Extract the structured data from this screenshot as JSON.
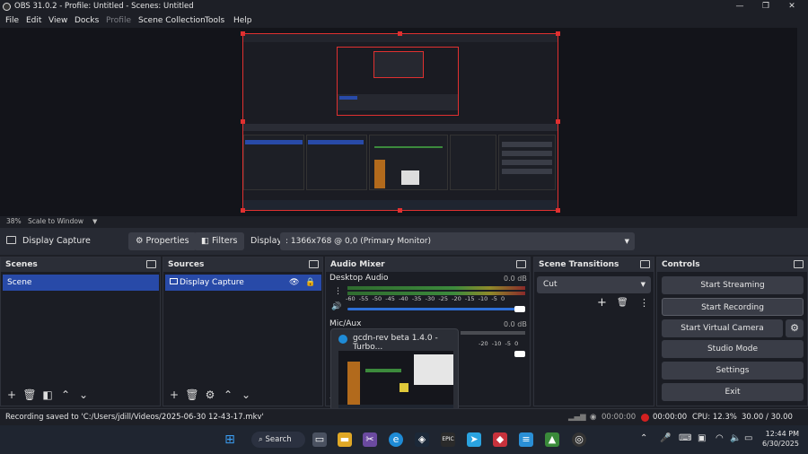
{
  "window": {
    "title": "OBS 31.0.2 - Profile: Untitled - Scenes: Untitled",
    "min": "—",
    "max": "❐",
    "close": "✕"
  },
  "menu": [
    "File",
    "Edit",
    "View",
    "Docks",
    "Profile",
    "Scene Collection",
    "Tools",
    "Help"
  ],
  "preview": {
    "zoom": "38%",
    "scale_mode": "Scale to Window",
    "border_color": "#e03030"
  },
  "source_toolbar": {
    "source_name": "Display Capture",
    "properties": "Properties",
    "filters": "Filters",
    "display_label": "Display",
    "display_value": ": 1366x768 @ 0,0 (Primary Monitor)"
  },
  "scenes": {
    "title": "Scenes",
    "items": [
      "Scene"
    ]
  },
  "sources": {
    "title": "Sources",
    "items": [
      "Display Capture"
    ]
  },
  "audio": {
    "title": "Audio Mixer",
    "channels": [
      {
        "name": "Desktop Audio",
        "db": "0.0 dB"
      },
      {
        "name": "Mic/Aux",
        "db": "0.0 dB"
      }
    ],
    "ticks": [
      "-60",
      "-55",
      "-50",
      "-45",
      "-40",
      "-35",
      "-30",
      "-25",
      "-20",
      "-15",
      "-10",
      "-5",
      "0"
    ]
  },
  "transitions": {
    "title": "Scene Transitions",
    "value": "Cut"
  },
  "controls": {
    "title": "Controls",
    "buttons": [
      "Start Streaming",
      "Start Recording",
      "Start Virtual Camera",
      "Studio Mode",
      "Settings",
      "Exit"
    ]
  },
  "tooltip": {
    "text": "gcdn-rev beta 1.4.0 - Turbo..."
  },
  "status": {
    "message": "Recording saved to 'C:/Users/jdill/Videos/2025-06-30 12-43-17.mkv'",
    "stream_time": "00:00:00",
    "rec_time": "00:00:00",
    "cpu": "CPU: 12.3%",
    "fps": "30.00 / 30.00 FPS"
  },
  "taskbar": {
    "search": "Search",
    "time": "12:44 PM",
    "date": "6/30/2025"
  }
}
